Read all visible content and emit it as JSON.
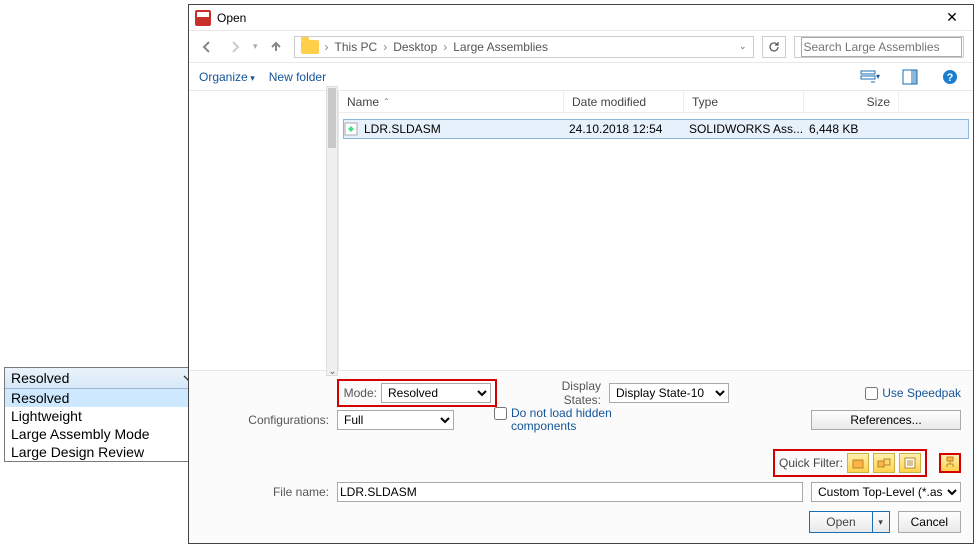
{
  "overlay_combo": {
    "selected": "Resolved",
    "options": [
      "Resolved",
      "Lightweight",
      "Large Assembly Mode",
      "Large Design Review"
    ]
  },
  "dialog": {
    "title": "Open",
    "nav": {
      "path_root": "This PC",
      "path_mid": "Desktop",
      "path_leaf": "Large Assemblies",
      "search_placeholder": "Search Large Assemblies"
    },
    "toolbar": {
      "organize": "Organize",
      "new_folder": "New folder"
    },
    "columns": {
      "name": "Name",
      "date": "Date modified",
      "type": "Type",
      "size": "Size"
    },
    "files": [
      {
        "name": "LDR.SLDASM",
        "date": "24.10.2018 12:54",
        "type": "SOLIDWORKS Ass...",
        "size": "6,448 KB"
      }
    ],
    "lower": {
      "mode_label": "Mode:",
      "mode_value": "Resolved",
      "config_label": "Configurations:",
      "config_value": "Full",
      "display_states_label": "Display States:",
      "display_states_value": "Display State-10",
      "use_speedpak": "Use Speedpak",
      "references": "References...",
      "do_not_load": "Do not load hidden components",
      "quick_filter": "Quick Filter:",
      "filename_label": "File name:",
      "filename_value": "LDR.SLDASM",
      "file_type": "Custom Top-Level (*.asm;*.slda",
      "open": "Open",
      "cancel": "Cancel"
    }
  }
}
